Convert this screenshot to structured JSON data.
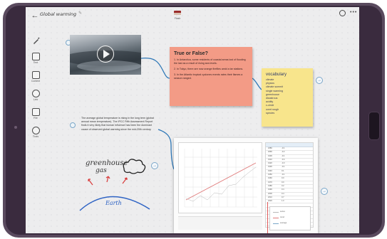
{
  "header": {
    "title": "Global warming",
    "flag_label": "Flash"
  },
  "toolbar": {
    "items": [
      {
        "label": "",
        "icon": "pen-icon"
      },
      {
        "label": "Text",
        "icon": "text-icon"
      },
      {
        "label": "Content",
        "icon": "content-icon"
      },
      {
        "label": "Link",
        "icon": "link-icon"
      },
      {
        "label": "File",
        "icon": "file-icon"
      },
      {
        "label": "Tools",
        "icon": "tools-icon"
      }
    ]
  },
  "quiz": {
    "title": "True or False?",
    "items": [
      "1. In Antarctica, some residents of coastal areas lost of flooding the last as a result of rising sea levels.",
      "2. In Tokyo, there are now orange fireflies amid a tar stations.",
      "3. In the Atlantic tropical cyclones events rates their flames a season ranged."
    ]
  },
  "vocabulary": {
    "title": "vocabulary",
    "words": [
      "climate",
      "physics",
      "climate summit",
      "single warming",
      "greenhouse",
      "disastrous",
      "acidity",
      "c-circle",
      "overt rough",
      "species"
    ]
  },
  "paragraph": {
    "text": "The average global temperature is rising in the long term (global annual mean temperature). The IPCC Fifth Assessment Report finds it very likely that human influence has been the dominant cause of observed global warming since the mid-20th century."
  },
  "sketch": {
    "line1": "greenhouse",
    "line2": "gas",
    "earth_label": "Earth"
  },
  "spreadsheet": {
    "rows": [
      [
        "1880",
        "-0.1"
      ],
      [
        "1890",
        "-0.2"
      ],
      [
        "1900",
        "-0.1"
      ],
      [
        "1910",
        "-0.4"
      ],
      [
        "1920",
        "-0.3"
      ],
      [
        "1930",
        "-0.1"
      ],
      [
        "1940",
        "0.1"
      ],
      [
        "1950",
        "-0.1"
      ],
      [
        "1960",
        "0.0"
      ],
      [
        "1970",
        "0.0"
      ],
      [
        "1980",
        "0.2"
      ],
      [
        "1990",
        "0.4"
      ],
      [
        "2000",
        "0.4"
      ],
      [
        "2010",
        "0.7"
      ],
      [
        "2020",
        "1.0"
      ],
      [
        "",
        ""
      ],
      [
        "",
        ""
      ],
      [
        "",
        ""
      ],
      [
        "",
        ""
      ],
      [
        "",
        ""
      ],
      [
        "",
        ""
      ]
    ],
    "legend": [
      "series",
      "trend",
      "average"
    ]
  },
  "colors": {
    "quiz_note": "#f39b86",
    "vocab_note": "#f8e58c",
    "connector": "#2f78b7",
    "sketch_red": "#d83a3a",
    "sketch_blue": "#2e63c4"
  }
}
